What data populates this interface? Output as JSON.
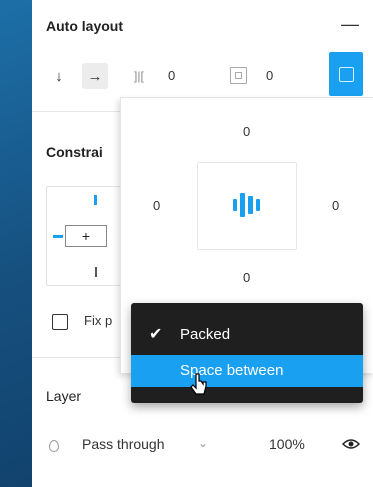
{
  "auto_layout": {
    "title": "Auto layout",
    "collapse_symbol": "—",
    "direction_vertical_symbol": "↓",
    "direction_horizontal_symbol": "→",
    "spacing_icon_symbol": "]|[",
    "spacing_value": "0",
    "padding_value": "0",
    "accent_color": "#1aa0f0"
  },
  "padding_popover": {
    "top": "0",
    "left": "0",
    "right": "0",
    "bottom": "0"
  },
  "constraints": {
    "title": "Constrai",
    "plus_symbol": "+",
    "fix_label": "Fix p"
  },
  "spacing_mode_menu": {
    "items": [
      {
        "label": "Packed",
        "checked": true
      },
      {
        "label": "Space between",
        "highlighted": true
      }
    ]
  },
  "layer": {
    "title": "Layer",
    "blend_mode": "Pass through",
    "blend_chevron": "⌄",
    "opacity": "100%"
  },
  "icons": {
    "collapse": "minus-icon",
    "visibility": "eye-icon",
    "blend": "drop-icon",
    "cursor": "pointer-cursor-icon"
  }
}
